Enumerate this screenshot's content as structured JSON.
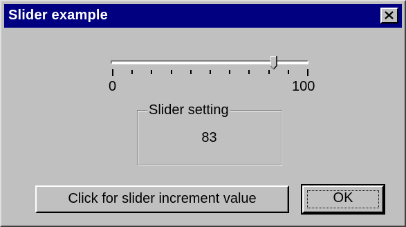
{
  "window": {
    "title": "Slider example"
  },
  "slider": {
    "min_label": "0",
    "max_label": "100",
    "value": 83,
    "min": 0,
    "max": 100,
    "tick_count": 11
  },
  "group": {
    "legend": "Slider setting",
    "value": "83"
  },
  "buttons": {
    "increment_label": "Click for slider increment value",
    "ok_label": "OK"
  },
  "icons": {
    "close": "close-icon"
  },
  "colors": {
    "titlebar": "#000080",
    "face": "#c0c0c0"
  }
}
